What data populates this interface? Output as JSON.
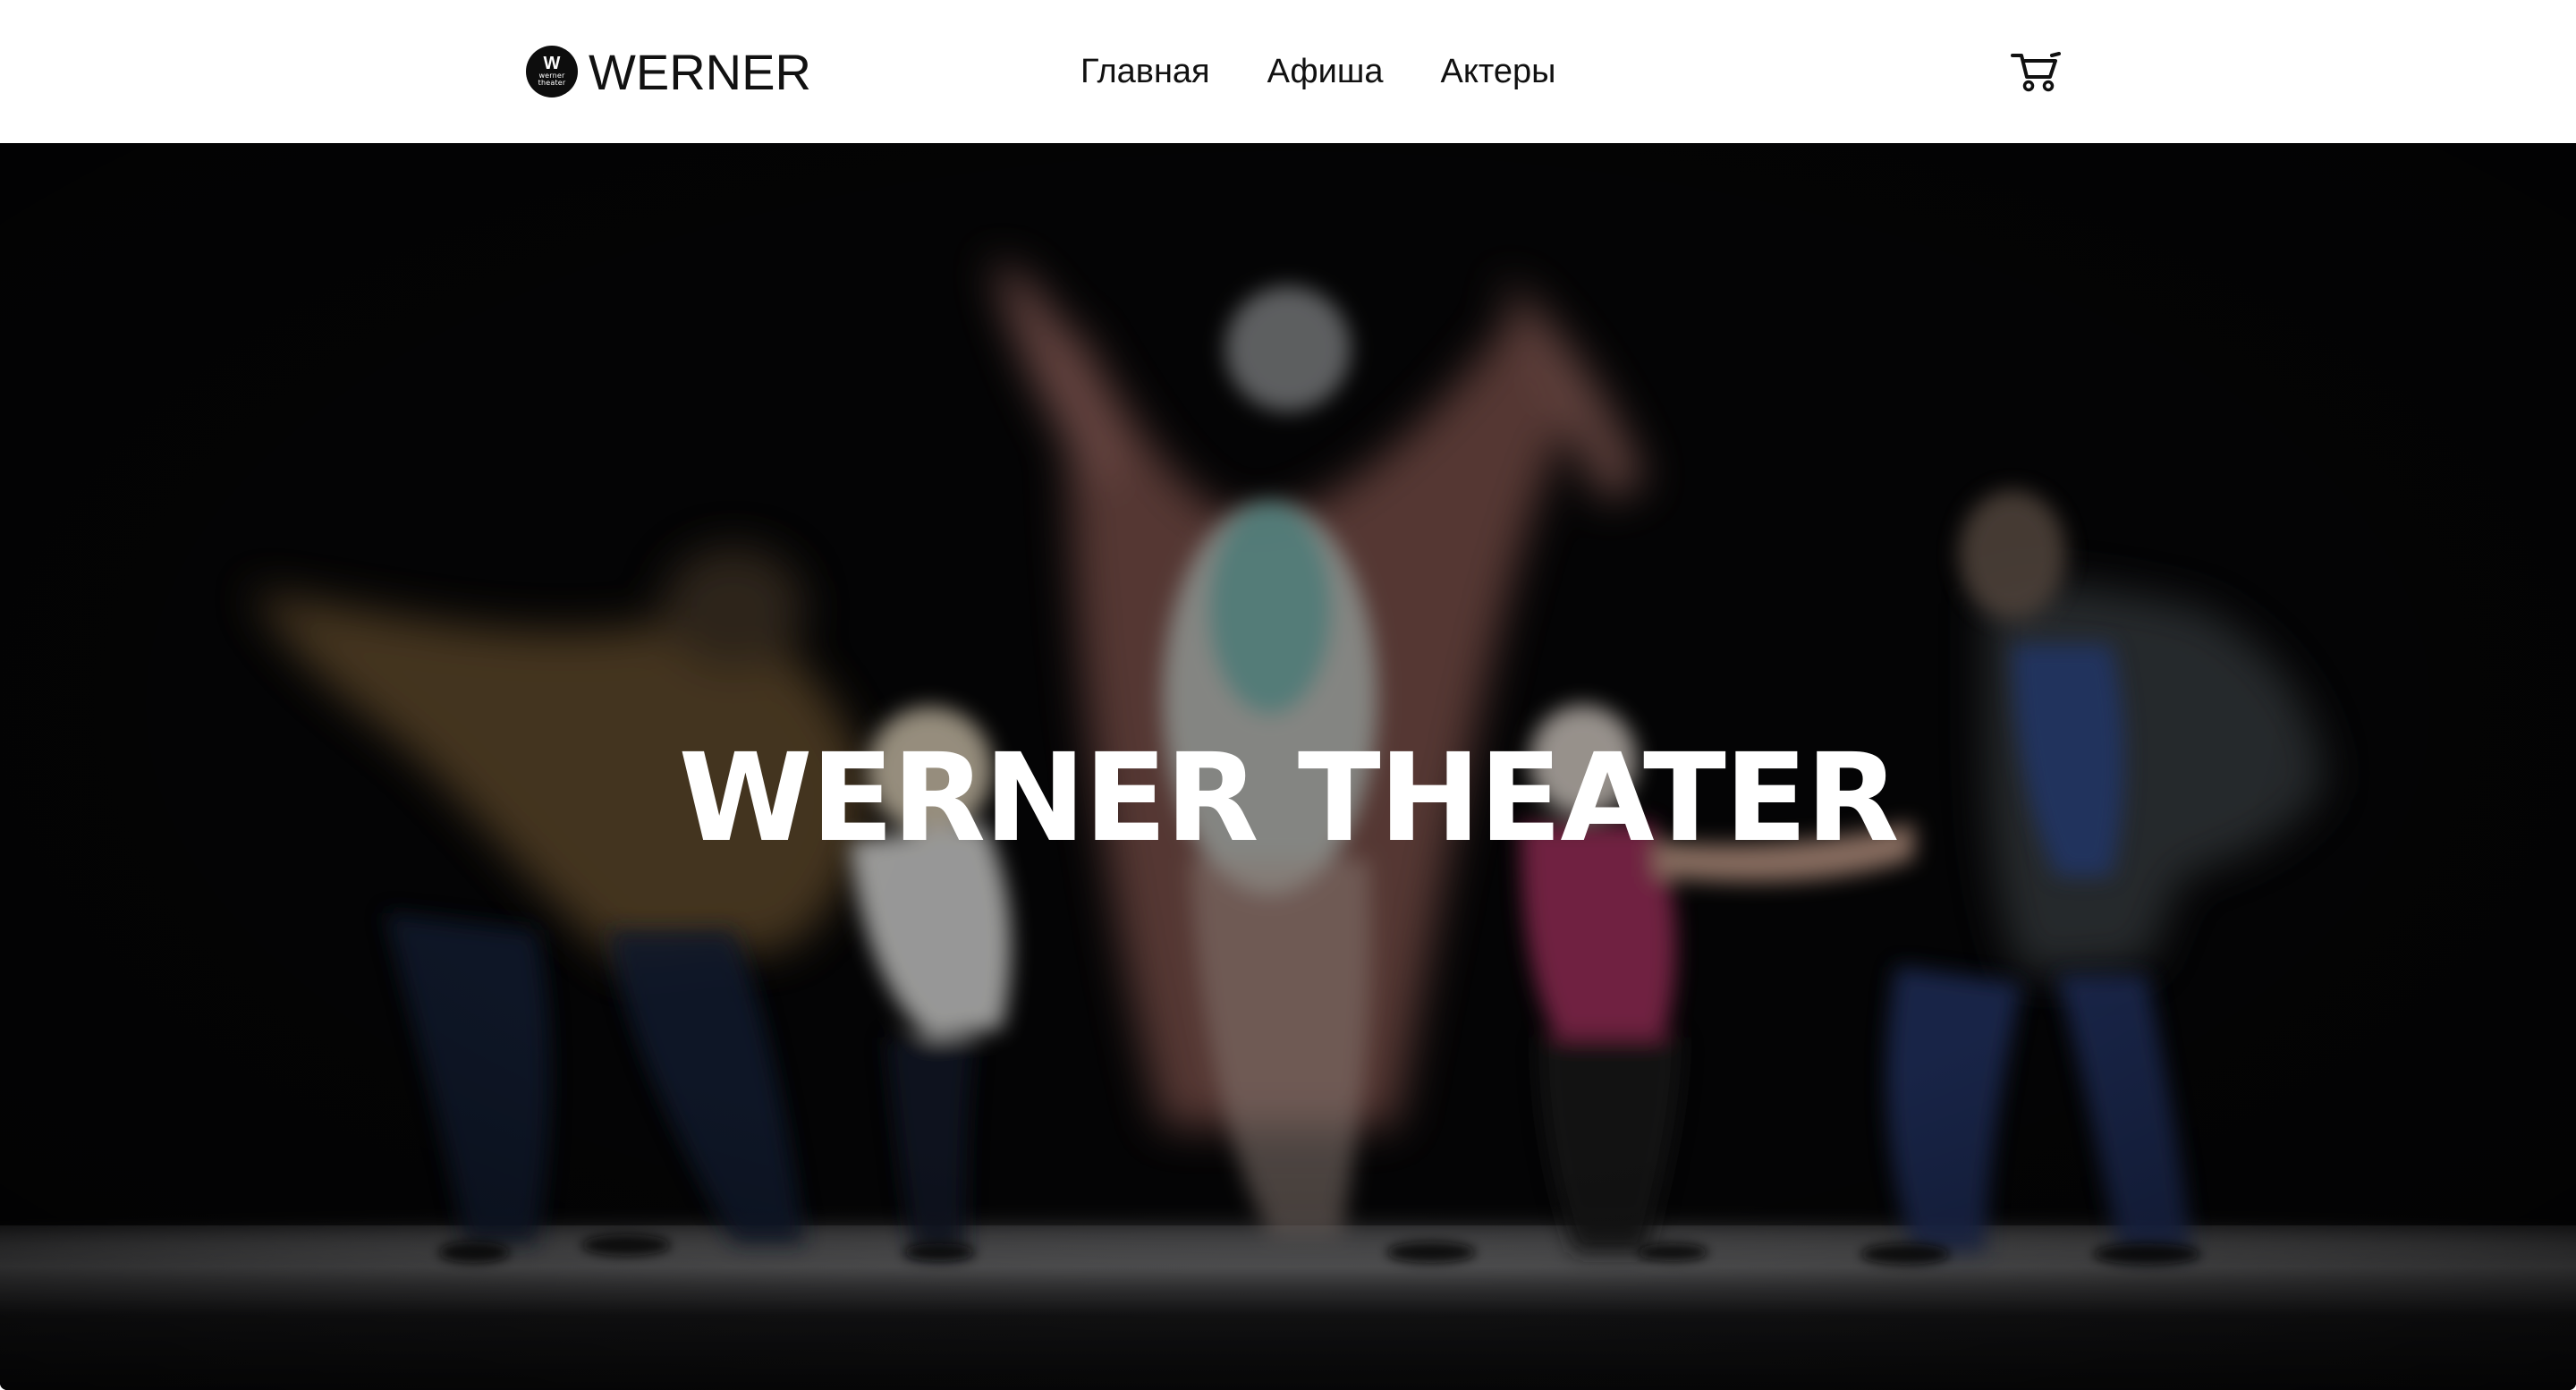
{
  "header": {
    "logo_badge_letter": "W",
    "logo_badge_line1": "werner",
    "logo_badge_line2": "theater",
    "logo_text": "WERNER",
    "nav": [
      {
        "label": "Главная"
      },
      {
        "label": "Афиша"
      },
      {
        "label": "Актеры"
      }
    ],
    "cart_icon": "cart-icon"
  },
  "hero": {
    "title": "WERNER THEATER",
    "image": "blurred-dancers-on-stage-image"
  },
  "colors": {
    "header_bg": "#ffffff",
    "hero_bg": "#050506",
    "text_dark": "#111111",
    "text_light": "#ffffff"
  }
}
